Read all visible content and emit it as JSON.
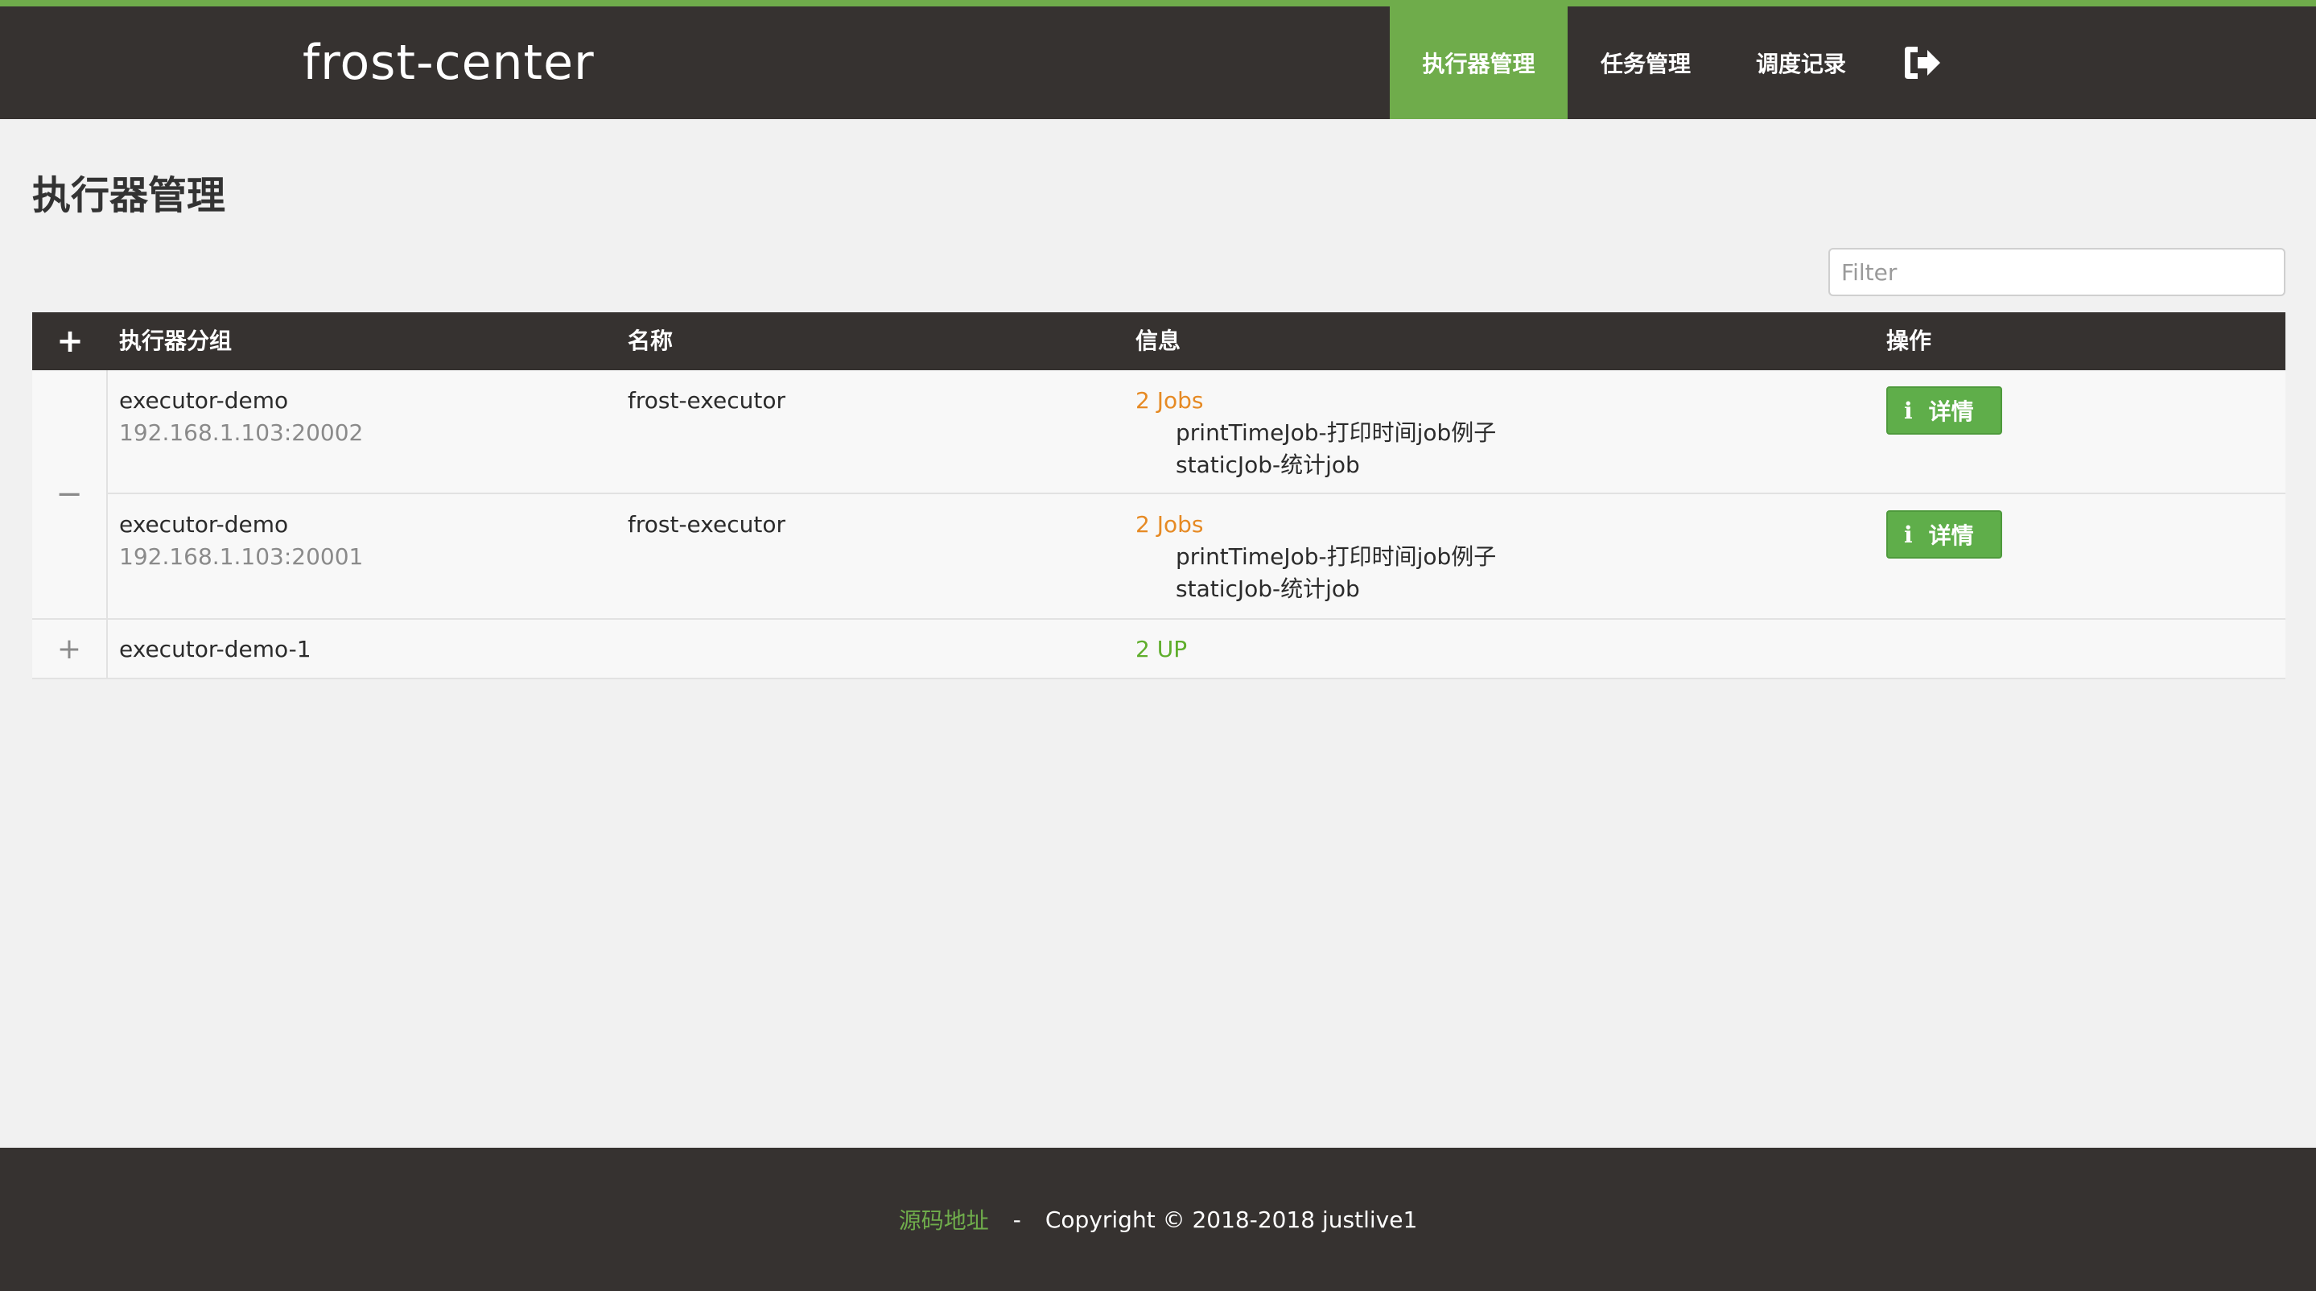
{
  "header": {
    "brand": "frost-center",
    "nav": [
      {
        "label": "执行器管理",
        "active": true
      },
      {
        "label": "任务管理",
        "active": false
      },
      {
        "label": "调度记录",
        "active": false
      }
    ],
    "logout_icon": "sign-out-icon"
  },
  "page": {
    "title": "执行器管理",
    "filter_placeholder": "Filter"
  },
  "table": {
    "expand_all_symbol": "+",
    "columns": [
      "执行器分组",
      "名称",
      "信息",
      "操作"
    ],
    "groups": [
      {
        "toggle_symbol": "−",
        "rows": [
          {
            "group": "executor-demo",
            "address": "192.168.1.103:20002",
            "name": "frost-executor",
            "jobs_count": "2 Jobs",
            "jobs": [
              "printTimeJob-打印时间job例子",
              "staticJob-统计job"
            ],
            "action_label": "详情"
          },
          {
            "group": "executor-demo",
            "address": "192.168.1.103:20001",
            "name": "frost-executor",
            "jobs_count": "2 Jobs",
            "jobs": [
              "printTimeJob-打印时间job例子",
              "staticJob-统计job"
            ],
            "action_label": "详情"
          }
        ]
      },
      {
        "toggle_symbol": "+",
        "group": "executor-demo-1",
        "status": "2 UP"
      }
    ]
  },
  "footer": {
    "source_link": "源码地址",
    "separator": "-",
    "copyright": "Copyright © 2018-2018 justlive1"
  },
  "colors": {
    "accent": "#6fac4b",
    "dark": "#363230",
    "jobs": "#e68a24",
    "up": "#5fae2c"
  }
}
